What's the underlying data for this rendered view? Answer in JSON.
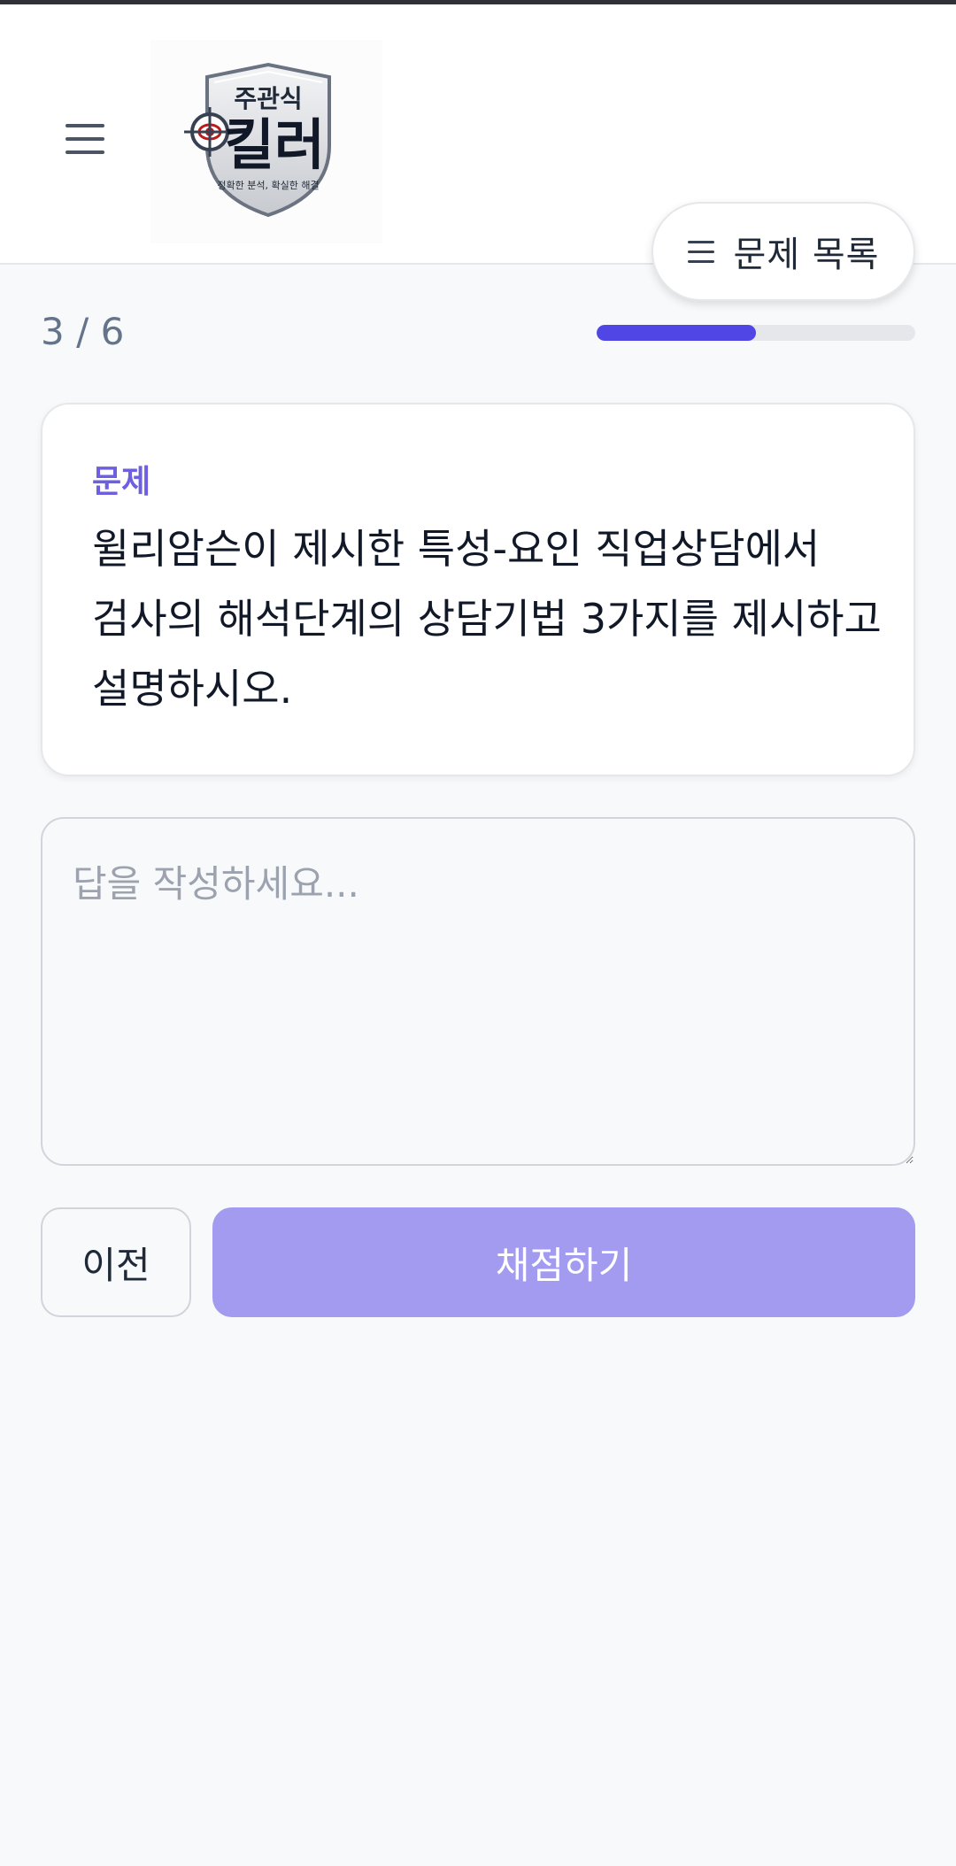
{
  "header": {
    "logo": {
      "title": "주관식",
      "name": "킬러",
      "slogan": "정확한 분석, 확실한 해결"
    },
    "problem_list_label": "문제 목록"
  },
  "progress": {
    "text": "3 / 6",
    "current": 3,
    "total": 6,
    "fraction": 0.5,
    "color": "#4f46e5"
  },
  "question": {
    "label": "문제",
    "text": "윌리암슨이 제시한 특성-요인 직업상담에서 검사의 해석단계의 상담기법 3가지를 제시하고 설명하시오."
  },
  "answer": {
    "placeholder": "답을 작성하세요...",
    "value": ""
  },
  "actions": {
    "prev_label": "이전",
    "grade_label": "채점하기",
    "grade_color": "#a29bf0"
  },
  "icons": [
    "hamburger-menu-icon",
    "list-icon",
    "crosshair-eye-icon"
  ]
}
